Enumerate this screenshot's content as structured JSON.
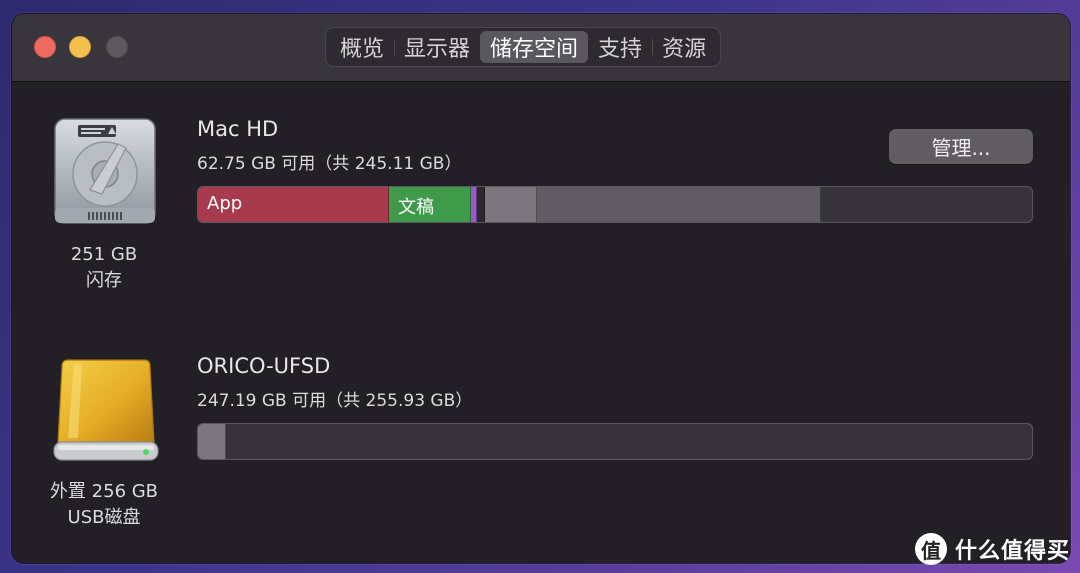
{
  "tabs": [
    "概览",
    "显示器",
    "储存空间",
    "支持",
    "资源"
  ],
  "active_tab": "储存空间",
  "drives": [
    {
      "capacity": "251 GB",
      "type": "闪存",
      "name": "Mac HD",
      "available": "62.75 GB 可用（共 245.11 GB）",
      "manage_label": "管理...",
      "segments": [
        {
          "label": "App",
          "fraction": 0.229,
          "color": "#a83a4e"
        },
        {
          "label": "文稿",
          "fraction": 0.098,
          "color": "#3f9a49"
        },
        {
          "label": "",
          "fraction": 0.007,
          "color": "#9b59c9"
        },
        {
          "label": "",
          "fraction": 0.01,
          "color": "#2b282f"
        },
        {
          "label": "",
          "fraction": 0.063,
          "color": "#7a777e"
        },
        {
          "label": "",
          "fraction": 0.34,
          "color": "#5f5c63"
        }
      ]
    },
    {
      "capacity": "外置 256 GB",
      "type": "USB磁盘",
      "name": "ORICO-UFSD",
      "available": "247.19 GB 可用（共 255.93 GB）",
      "segments": [
        {
          "label": "",
          "fraction": 0.034,
          "color": "#7a777e"
        }
      ]
    }
  ],
  "watermark": {
    "icon_text": "值",
    "text": "什么值得买"
  }
}
